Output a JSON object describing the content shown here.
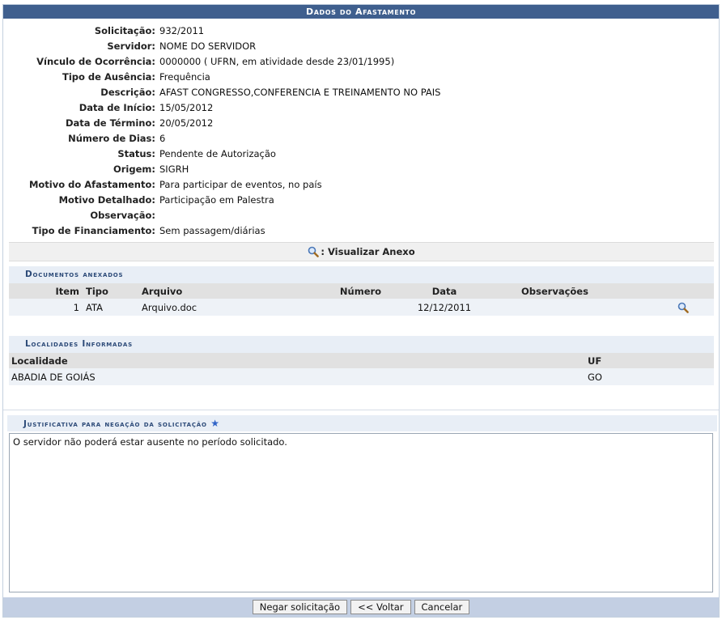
{
  "panel": {
    "title": "Dados do Afastamento"
  },
  "details": [
    {
      "label": "Solicitação:",
      "value": "932/2011"
    },
    {
      "label": "Servidor:",
      "value": "NOME DO SERVIDOR"
    },
    {
      "label": "Vínculo de Ocorrência:",
      "value": "0000000 ( UFRN, em atividade desde 23/01/1995)"
    },
    {
      "label": "Tipo de Ausência:",
      "value": "Frequência"
    },
    {
      "label": "Descrição:",
      "value": "AFAST CONGRESSO,CONFERENCIA E TREINAMENTO NO PAIS"
    },
    {
      "label": "Data de Início:",
      "value": "15/05/2012"
    },
    {
      "label": "Data de Término:",
      "value": "20/05/2012"
    },
    {
      "label": "Número de Dias:",
      "value": "6"
    },
    {
      "label": "Status:",
      "value": "Pendente de Autorização"
    },
    {
      "label": "Origem:",
      "value": "SIGRH"
    },
    {
      "label": "Motivo do Afastamento:",
      "value": "Para participar de eventos, no país"
    },
    {
      "label": "Motivo Detalhado:",
      "value": "Participação em Palestra"
    },
    {
      "label": "Observação:",
      "value": ""
    },
    {
      "label": "Tipo de Financiamento:",
      "value": "Sem passagem/diárias"
    }
  ],
  "view_attachment": {
    "label": ": Visualizar Anexo",
    "icon": "magnifier-icon"
  },
  "documents": {
    "title": "Documentos anexados",
    "headers": {
      "item": "Item",
      "tipo": "Tipo",
      "arquivo": "Arquivo",
      "numero": "Número",
      "data": "Data",
      "observacoes": "Observações"
    },
    "rows": [
      {
        "item": "1",
        "tipo": "ATA",
        "arquivo": "Arquivo.doc",
        "numero": "",
        "data": "12/12/2011",
        "observacoes": ""
      }
    ]
  },
  "localities": {
    "title": "Localidades Informadas",
    "headers": {
      "localidade": "Localidade",
      "uf": "UF"
    },
    "rows": [
      {
        "localidade": "ABADIA DE GOIÁS",
        "uf": "GO"
      }
    ]
  },
  "justification": {
    "title": "Justificativa para negação da solicitação",
    "required_mark": "★",
    "value": "O servidor não poderá estar ausente no período solicitado."
  },
  "buttons": {
    "deny": "Negar solicitação",
    "back": "<< Voltar",
    "cancel": "Cancelar"
  },
  "colors": {
    "title_bar": "#3f5f8e",
    "sub_header": "#e8eef6",
    "footer": "#c3cfe3"
  }
}
